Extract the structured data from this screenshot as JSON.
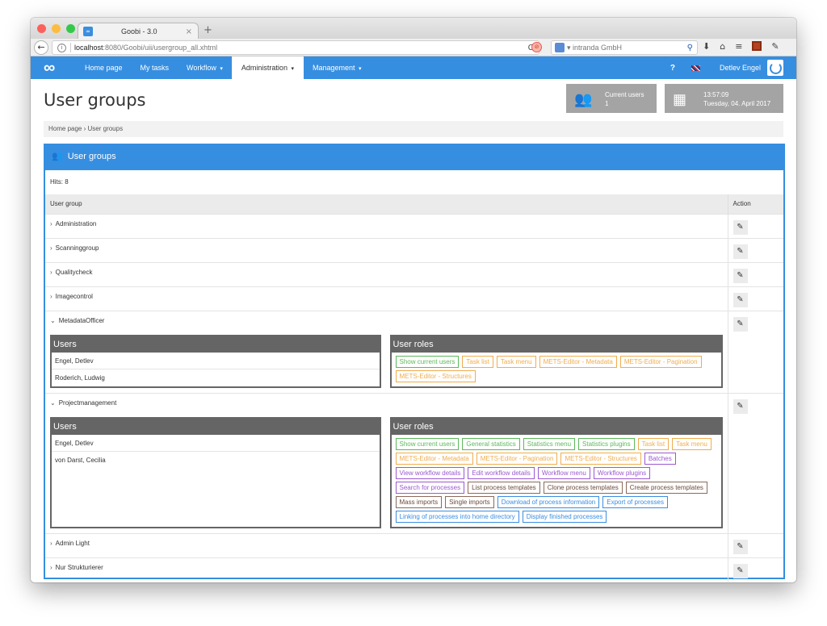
{
  "browser": {
    "tab_title": "Goobi - 3.0",
    "tab_favicon": "∞",
    "tab_close": "×",
    "new_tab": "+",
    "url_host": "localhost",
    "url_rest": ":8080/Goobi/uii/usergroup_all.xhtml",
    "search_placeholder": "intranda GmbH",
    "back_icon": "←",
    "reload_icon": "C",
    "info_icon": "i",
    "search_icon": "⚲",
    "download_icon": "⬇",
    "home_icon": "⌂",
    "menu_icon": "≡",
    "eyedropper_icon": "✎"
  },
  "nav": {
    "logo": "∞",
    "items": [
      {
        "label": "Home page",
        "dropdown": false,
        "active": false
      },
      {
        "label": "My tasks",
        "dropdown": false,
        "active": false
      },
      {
        "label": "Workflow",
        "dropdown": true,
        "active": false
      },
      {
        "label": "Administration",
        "dropdown": true,
        "active": true
      },
      {
        "label": "Management",
        "dropdown": true,
        "active": false
      }
    ],
    "caret": "▾",
    "help": "?",
    "user_name": "Detlev Engel"
  },
  "header": {
    "title": "User groups",
    "current_users_label": "Current users",
    "current_users_value": "1",
    "time": "13:57:09",
    "date": "Tuesday, 04. April 2017",
    "users_icon": "👥",
    "calendar_icon": "📅"
  },
  "breadcrumb": {
    "home": "Home page",
    "separator": "›",
    "current": "User groups"
  },
  "box": {
    "title": "User groups",
    "hits": "Hits: 8",
    "col_group": "User group",
    "col_action": "Action",
    "users_heading": "Users",
    "roles_heading": "User roles",
    "edit_icon": "✎",
    "chevron_collapsed": "›",
    "chevron_expanded": "⌄"
  },
  "groups": [
    {
      "name": "Administration",
      "expanded": false
    },
    {
      "name": "Scanninggroup",
      "expanded": false
    },
    {
      "name": "Qualitycheck",
      "expanded": false
    },
    {
      "name": "Imagecontrol",
      "expanded": false
    },
    {
      "name": "MetadataOfficer",
      "expanded": true,
      "users": [
        "Engel, Detlev",
        "Roderich, Ludwig"
      ],
      "roles": [
        {
          "label": "Show current users",
          "color": "green"
        },
        {
          "label": "Task list",
          "color": "orange"
        },
        {
          "label": "Task menu",
          "color": "orange"
        },
        {
          "label": "METS-Editor - Metadata",
          "color": "orange"
        },
        {
          "label": "METS-Editor - Pagination",
          "color": "orange"
        },
        {
          "label": "METS-Editor - Structures",
          "color": "orange"
        }
      ]
    },
    {
      "name": "Projectmanagement",
      "expanded": true,
      "users": [
        "Engel, Detlev",
        "von Darst, Cecilia"
      ],
      "roles": [
        {
          "label": "Show current users",
          "color": "green"
        },
        {
          "label": "General statistics",
          "color": "green"
        },
        {
          "label": "Statistics menu",
          "color": "green"
        },
        {
          "label": "Statistics plugins",
          "color": "green"
        },
        {
          "label": "Task list",
          "color": "orange"
        },
        {
          "label": "Task menu",
          "color": "orange"
        },
        {
          "label": "METS-Editor - Metadata",
          "color": "orange"
        },
        {
          "label": "METS-Editor - Pagination",
          "color": "orange"
        },
        {
          "label": "METS-Editor - Structures",
          "color": "orange"
        },
        {
          "label": "Batches",
          "color": "purple"
        },
        {
          "label": "View workflow details",
          "color": "purple"
        },
        {
          "label": "Edit workflow details",
          "color": "purple"
        },
        {
          "label": "Workflow menu",
          "color": "purple"
        },
        {
          "label": "Workflow plugins",
          "color": "purple"
        },
        {
          "label": "Search for processes",
          "color": "purple"
        },
        {
          "label": "List process templates",
          "color": "brown"
        },
        {
          "label": "Clone process templates",
          "color": "brown"
        },
        {
          "label": "Create process templates",
          "color": "brown"
        },
        {
          "label": "Mass imports",
          "color": "brown"
        },
        {
          "label": "Single imports",
          "color": "brown"
        },
        {
          "label": "Download of process information",
          "color": "blue"
        },
        {
          "label": "Export of processes",
          "color": "blue"
        },
        {
          "label": "Linking of processes into home directory",
          "color": "blue"
        },
        {
          "label": "Display finished processes",
          "color": "blue"
        }
      ]
    },
    {
      "name": "Admin Light",
      "expanded": false
    },
    {
      "name": "Nur Strukturierer",
      "expanded": false
    }
  ],
  "colors": {
    "brand": "#368ee0",
    "panel": "#656565",
    "green": "#5cb85c",
    "orange": "#f0ad4e",
    "purple": "#9b59d0",
    "brown": "#8b6a5a",
    "blue": "#3a8ee0"
  }
}
